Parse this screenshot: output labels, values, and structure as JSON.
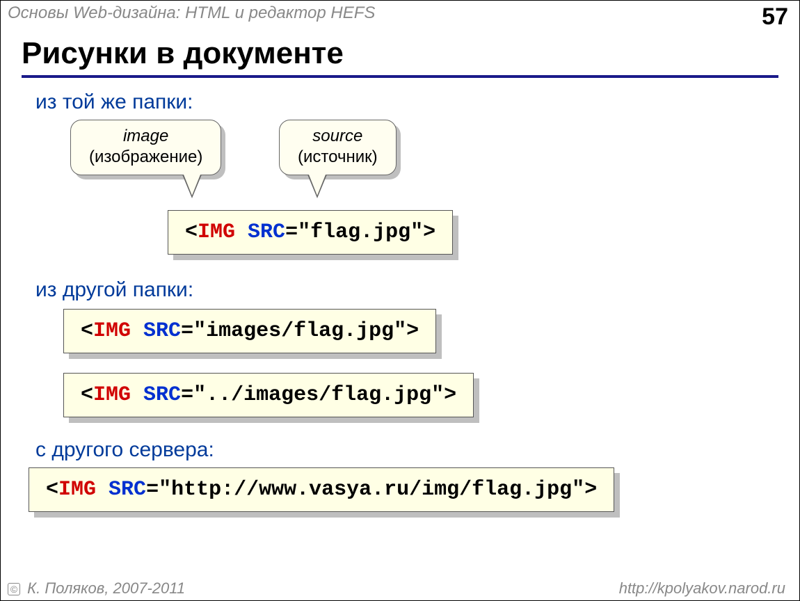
{
  "header": {
    "title": "Основы Web-дизайна: HTML и редактор HEFS",
    "page_number": "57"
  },
  "title": "Рисунки в документе",
  "sections": {
    "same_folder": "из той же папки:",
    "other_folder": "из другой папки:",
    "other_server": "с другого сервера:"
  },
  "callouts": {
    "image": {
      "line1": "image",
      "line2": "(изображение)"
    },
    "source": {
      "line1": "source",
      "line2": "(источник)"
    }
  },
  "code": {
    "bracket_open": "<",
    "bracket_close": ">",
    "tag": "IMG",
    "attr": "SRC",
    "eq": "=",
    "vals": {
      "same": "\"flag.jpg\"",
      "folder1": "\"images/flag.jpg\"",
      "folder2": "\"../images/flag.jpg\"",
      "server": "\"http://www.vasya.ru/img/flag.jpg\""
    }
  },
  "footer": {
    "copyright": "К. Поляков, 2007-2011",
    "url": "http://kpolyakov.narod.ru"
  }
}
